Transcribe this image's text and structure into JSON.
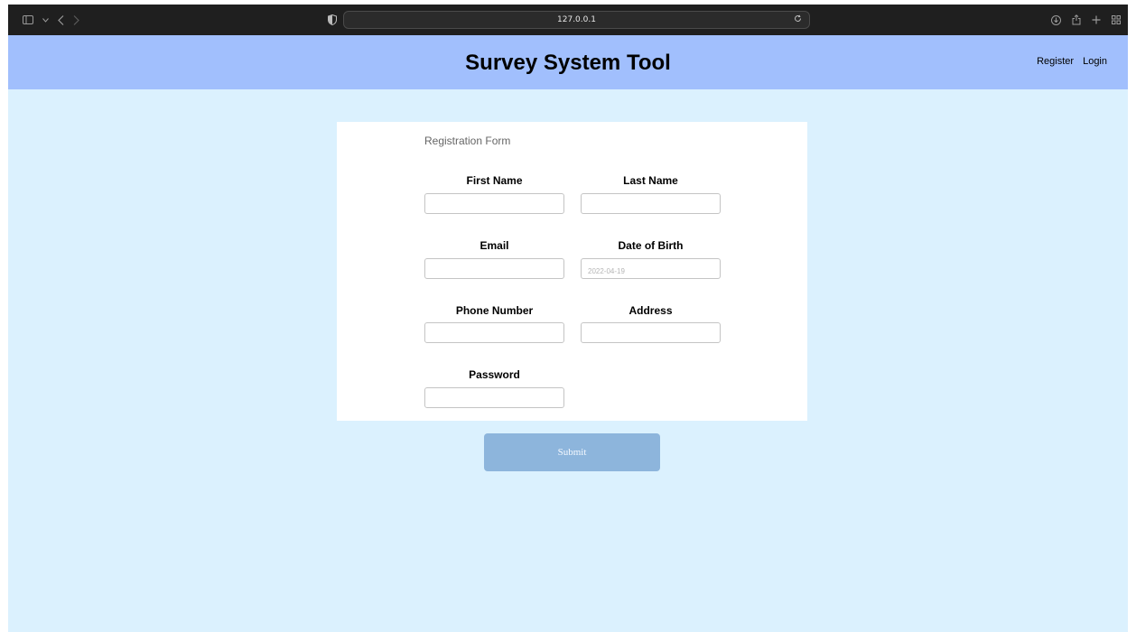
{
  "browser": {
    "url": "127.0.0.1",
    "icons": {
      "sidebar": "sidebar-icon",
      "back": "back-arrow-icon",
      "forward": "forward-arrow-icon",
      "shield": "privacy-shield-icon",
      "reload": "reload-icon",
      "download": "download-icon",
      "share": "share-icon",
      "new_tab": "plus-icon",
      "tabs": "tab-overview-icon"
    }
  },
  "header": {
    "title": "Survey System Tool",
    "nav": [
      "Register",
      "Login"
    ],
    "color": "#a1bffd"
  },
  "form": {
    "title": "Registration Form",
    "fields": {
      "first_name": {
        "label": "First Name",
        "value": ""
      },
      "last_name": {
        "label": "Last Name",
        "value": ""
      },
      "email": {
        "label": "Email",
        "value": ""
      },
      "dob": {
        "label": "Date of Birth",
        "placeholder": "2022-04-19"
      },
      "phone": {
        "label": "Phone Number",
        "value": ""
      },
      "address": {
        "label": "Address",
        "value": ""
      },
      "password": {
        "label": "Password",
        "value": ""
      }
    },
    "submit_label": "Submit"
  },
  "colors": {
    "page_bg": "#dbf1fe",
    "submit_bg": "#8db5dc"
  }
}
